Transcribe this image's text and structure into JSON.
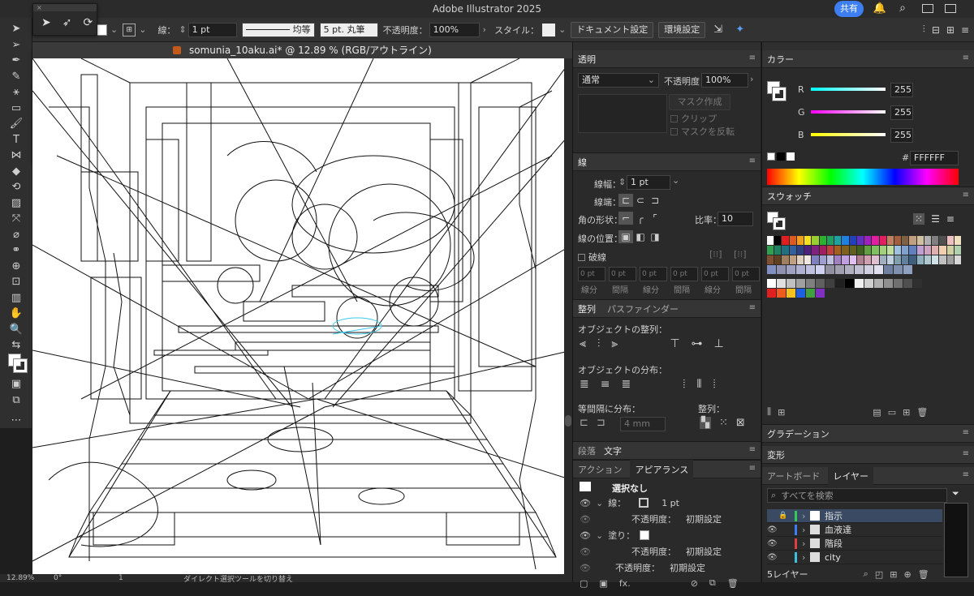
{
  "app": {
    "title": "Adobe Illustrator 2025",
    "share_label": "共有"
  },
  "control": {
    "stroke_label": "線：",
    "stroke_weight": "1 pt",
    "profile_label": "均等",
    "brush_label": "5 pt. 丸筆",
    "opacity_label": "不透明度：",
    "opacity_value": "100%",
    "style_label": "スタイル：",
    "doc_settings": "ドキュメント設定",
    "env_settings": "環境設定"
  },
  "document": {
    "tab_title": "somunia_10aku.ai* @ 12.89 % (RGB/アウトライン)"
  },
  "status": {
    "zoom": "12.89%",
    "rotation": "0°",
    "artboard": "1",
    "hint": "ダイレクト選択ツールを切り替え"
  },
  "transparency": {
    "title": "透明",
    "blend_mode": "通常",
    "opacity_label": "不透明度：",
    "opacity_value": "100%",
    "make_mask": "マスク作成",
    "clip": "クリップ",
    "invert_mask": "マスクを反転"
  },
  "stroke_panel": {
    "title": "線",
    "weight_label": "線幅：",
    "weight_value": "1 pt",
    "cap_label": "線端：",
    "corner_label": "角の形状：",
    "limit_label": "比率：",
    "limit_value": "10",
    "align_label": "線の位置：",
    "dashed_label": "破線",
    "dash_values": [
      "0 pt",
      "0 pt",
      "0 pt",
      "0 pt",
      "0 pt",
      "0 pt"
    ],
    "dash_labels": [
      "線分",
      "間隔",
      "線分",
      "間隔",
      "線分",
      "間隔"
    ]
  },
  "align_panel": {
    "tab_align": "整列",
    "tab_pathfinder": "パスファインダー",
    "objects_align": "オブジェクトの整列：",
    "objects_distribute": "オブジェクトの分布：",
    "spacing_distribute": "等間隔に分布：",
    "align_to": "整列：",
    "spacing_value": "4 mm"
  },
  "paragraph_tabs": {
    "tab1": "段落",
    "tab2": "文字"
  },
  "appearance": {
    "tab_actions": "アクション",
    "tab_appearance": "アピアランス",
    "selection": "選択なし",
    "stroke_label": "線：",
    "stroke_value": "1 pt",
    "opacity_label": "不透明度：",
    "opacity_value": "初期設定",
    "fill_label": "塗り：",
    "fill_opacity_label": "不透明度：",
    "fill_opacity_value": "初期設定",
    "total_opacity_label": "不透明度：",
    "total_opacity_value": "初期設定"
  },
  "color_panel": {
    "title": "カラー",
    "r_label": "R",
    "r_value": "255",
    "g_label": "G",
    "g_value": "255",
    "b_label": "B",
    "b_value": "255",
    "hex_label": "#",
    "hex_value": "FFFFFF"
  },
  "swatches": {
    "title": "スウォッチ",
    "rows": [
      [
        "#ffffff",
        "#000000",
        "#e02020",
        "#e05a20",
        "#f0a020",
        "#f5e020",
        "#9acd32",
        "#30b030",
        "#20a060",
        "#20a0a0",
        "#2080e0",
        "#2040c0",
        "#6030c0",
        "#a020c0",
        "#e020a0",
        "#e02060",
        "#c08060",
        "#a06040",
        "#806040",
        "#c0a080",
        "#d0c0a0",
        "#b0b0b0",
        "#808080",
        "#505050",
        "#f0c0c0",
        "#f0e0c0"
      ],
      [
        "#30a050",
        "#208060",
        "#207080",
        "#3060a0",
        "#304080",
        "#502080",
        "#802080",
        "#a02060",
        "#c04040",
        "#a06020",
        "#806020",
        "#606020",
        "#406020",
        "#60a040",
        "#80c060",
        "#a0d080",
        "#c0e0a0",
        "#a0c0e0",
        "#80a0d0",
        "#6080c0",
        "#c0a0d0",
        "#d0a0c0",
        "#e0b0b0",
        "#f0d0b0",
        "#d0d0a0",
        "#b0d0b0"
      ],
      [
        "#805030",
        "#604020",
        "#a08060",
        "#c0a080",
        "#e0d0c0",
        "#f0e8e0",
        "#8080c0",
        "#a0a0d0",
        "#c0c0e0",
        "#a080c0",
        "#c0a0e0",
        "#e0c0f0",
        "#b08090",
        "#d0a0b0",
        "#e0c0d0",
        "#a0b0c0",
        "#c0d0e0",
        "#80a0b0",
        "#6080a0",
        "#406080",
        "#90b0c0",
        "#b0c8d0",
        "#d0e0e8",
        "#c0c0c0",
        "#a0a0a0",
        "#d8d8d8"
      ],
      [
        "#8090c0",
        "#9090b0",
        "#a0a0c0",
        "#b0b0d0",
        "#c0c0e0",
        "#d0d0f0",
        "#9090a0",
        "#a0a0b0",
        "#b0b0c0",
        "#c0c0d0",
        "#d0d0e0",
        "#e0e0f0",
        "#7080a0",
        "#8090b0",
        "#90a0c0"
      ],
      [
        "#ffffff",
        "#e0e0e0",
        "#c0c0c0",
        "#a0a0a0",
        "#808080",
        "#606060",
        "#404040",
        "#202020",
        "#000000",
        "#f0f0f0",
        "#d0d0d0",
        "#b0b0b0",
        "#909090",
        "#707070",
        "#505050",
        "#303030"
      ],
      [
        "#e02020",
        "#f05a20",
        "#f5c020",
        "#2060e0",
        "#40a040",
        "#8030c0"
      ]
    ]
  },
  "gradient": {
    "title": "グラデーション"
  },
  "transform": {
    "title": "変形"
  },
  "layers": {
    "tab_artboard": "アートボード",
    "tab_layers": "レイヤー",
    "search_placeholder": "すべてを検索",
    "items": [
      {
        "name": "指示",
        "color": "#34c759"
      },
      {
        "name": "血液達",
        "color": "#3d7ff2"
      },
      {
        "name": "階段",
        "color": "#e04040"
      },
      {
        "name": "city",
        "color": "#40c0e0"
      }
    ],
    "count_label": "5レイヤー"
  }
}
